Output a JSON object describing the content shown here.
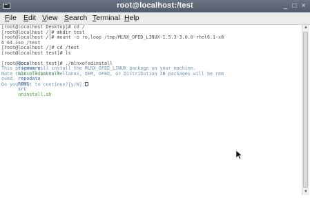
{
  "window": {
    "title": "root@localhost:/test",
    "minimize_glyph": "_",
    "maximize_glyph": "□",
    "close_glyph": "×"
  },
  "menu": {
    "items": [
      {
        "mnemonic": "F",
        "rest": "ile"
      },
      {
        "mnemonic": "E",
        "rest": "dit"
      },
      {
        "mnemonic": "V",
        "rest": "iew"
      },
      {
        "mnemonic": "S",
        "rest": "earch"
      },
      {
        "mnemonic": "T",
        "rest": "erminal"
      },
      {
        "mnemonic": "H",
        "rest": "elp"
      }
    ]
  },
  "terminal": {
    "lines": [
      "[root@localhost Desktop]# cd /",
      "[root@localhost /]# mkdir test",
      "[root@localhost /]# mount -o ro,loop /tmp/MLNX_OFED_LINUX-1.5.3-3.0.0-rhel6.1-x8",
      "6_64.iso /test",
      "[root@localhost /]# cd /test",
      "[root@localhost test]# ls"
    ],
    "ls_entries": [
      {
        "name": "docs",
        "type": "dir"
      },
      {
        "name": "firmware",
        "type": "dir"
      },
      {
        "name": "mlnxofedinstall",
        "type": "exec"
      },
      {
        "name": "repodata",
        "type": "dir"
      },
      {
        "name": "RPMS",
        "type": "dir"
      },
      {
        "name": "src",
        "type": "dir"
      },
      {
        "name": "uninstall.sh",
        "type": "exec"
      }
    ],
    "install_command": "[root@localhost test]# ./mlnxofedinstall",
    "info_lines": [
      "This program will install the MLNX_OFED_LINUX package on your machine.",
      "Note that all other Mellanox, OEM, OFED, or Distribution IB packages will be rem",
      "oved.",
      "Do you want to continue?[y/N]:"
    ]
  },
  "colors": {
    "text": "#4a4f57",
    "info": "#6e93b3",
    "directory": "#3d5fa8",
    "executable": "#4aa02c",
    "titlebar": "#5d6776"
  },
  "icons": [
    "terminal-app-icon",
    "minimize-icon",
    "maximize-icon",
    "close-icon",
    "scroll-up-arrow-icon",
    "scroll-down-arrow-icon",
    "mouse-pointer-icon"
  ]
}
